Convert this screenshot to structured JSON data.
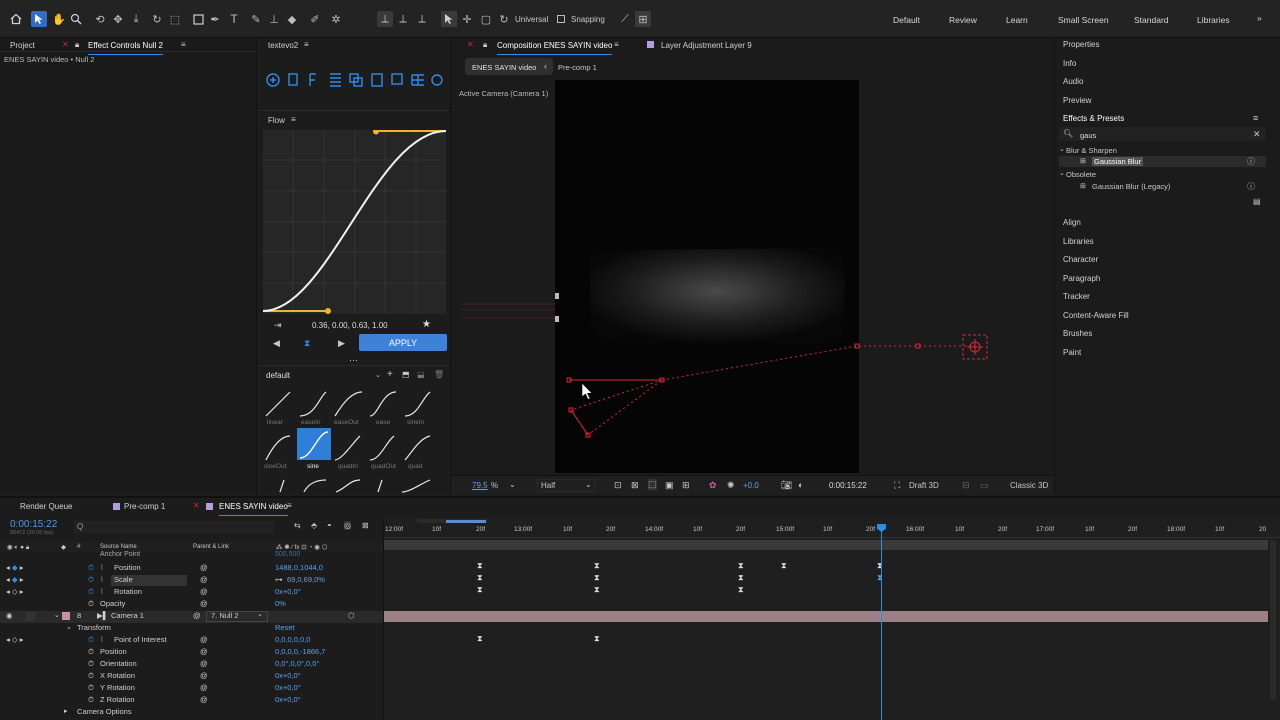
{
  "toolbar": {
    "axis_mode": "Universal",
    "snapping": "Snapping"
  },
  "workspaces": [
    "Default",
    "Review",
    "Learn",
    "Small Screen",
    "Standard",
    "Libraries"
  ],
  "left_panel": {
    "tab_project": "Project",
    "tab_effect_controls": "Effect Controls Null 2",
    "breadcrumb": "ENES SAYIN video • Null 2"
  },
  "flow_panel": {
    "tab_title": "textevo2",
    "flow_title": "Flow",
    "curve_values": "0.36, 0.00, 0.63, 1.00",
    "apply_label": "APPLY",
    "preset_group": "default",
    "presets_row1": [
      "linear",
      "easeIn",
      "easeOut",
      "ease",
      "sineIn"
    ],
    "presets_row2": [
      "sineOut",
      "sine",
      "quadIn",
      "quadOut",
      "quad"
    ]
  },
  "composition": {
    "tab_label": "Composition ENES SAYIN video",
    "layer_tab": "Layer Adjustment Layer 9",
    "crumb_main": "ENES SAYIN video",
    "crumb_sub": "Pre-comp 1",
    "camera_label": "Active Camera (Camera 1)",
    "zoom": "79.5",
    "zoom_unit": "%",
    "resolution": "Half",
    "exposure": "+0.0",
    "timecode": "0:00:15:22",
    "renderer": "Draft 3D",
    "render_mode": "Classic 3D"
  },
  "right_panel": {
    "items_top": [
      "Properties",
      "Info",
      "Audio",
      "Preview",
      "Effects & Presets"
    ],
    "search_value": "gaus",
    "category_blur": "Blur & Sharpen",
    "item_gaussian": "Gaussian Blur",
    "category_obsolete": "Obsolete",
    "item_gaussian_legacy": "Gaussian Blur (Legacy)",
    "items_bottom": [
      "Align",
      "Libraries",
      "Character",
      "Paragraph",
      "Tracker",
      "Content-Aware Fill",
      "Brushes",
      "Paint"
    ]
  },
  "timeline": {
    "tabs": [
      "Render Queue",
      "Pre-comp 1",
      "ENES SAYIN video"
    ],
    "current_time": "0:00:15:22",
    "frame_info": "00472 (30.00 fps)",
    "search_placeholder": "Q",
    "col_source": "Source Name",
    "col_parent": "Parent & Link",
    "ruler_labels": [
      "12:00f",
      "10f",
      "20f",
      "13:00f",
      "10f",
      "20f",
      "14:00f",
      "10f",
      "20f",
      "15:00f",
      "10f",
      "20f",
      "16:00f",
      "10f",
      "20f",
      "17:00f",
      "10f",
      "20f",
      "18:00f",
      "10f",
      "20"
    ],
    "rows": {
      "anchor": {
        "name": "Anchor Point",
        "value": "500,500"
      },
      "position": {
        "name": "Position",
        "value": "1488,0,1044,0"
      },
      "scale": {
        "name": "Scale",
        "value": "69,0,69,0%"
      },
      "rotation": {
        "name": "Rotation",
        "value": "0x+0,0°"
      },
      "opacity": {
        "name": "Opacity",
        "value": "0%"
      },
      "camera": {
        "num": "8",
        "name": "Camera 1",
        "parent": "7. Null 2"
      },
      "transform": {
        "name": "Transform",
        "value": "Reset"
      },
      "poi": {
        "name": "Point of Interest",
        "value": "0,0,0,0,0,0"
      },
      "cam_position": {
        "name": "Position",
        "value": "0,0,0,0,-1866,7"
      },
      "orientation": {
        "name": "Orientation",
        "value": "0,0°,0,0°,0,0°"
      },
      "xrot": {
        "name": "X Rotation",
        "value": "0x+0,0°"
      },
      "yrot": {
        "name": "Y Rotation",
        "value": "0x+0,0°"
      },
      "zrot": {
        "name": "Z Rotation",
        "value": "0x+0,0°"
      },
      "camera_options": {
        "name": "Camera Options"
      }
    }
  },
  "colors": {
    "accent_blue": "#2d8ceb",
    "flow_yellow": "#f0b429",
    "motion_red": "#d7263d",
    "camera_layer": "#9c8088"
  }
}
